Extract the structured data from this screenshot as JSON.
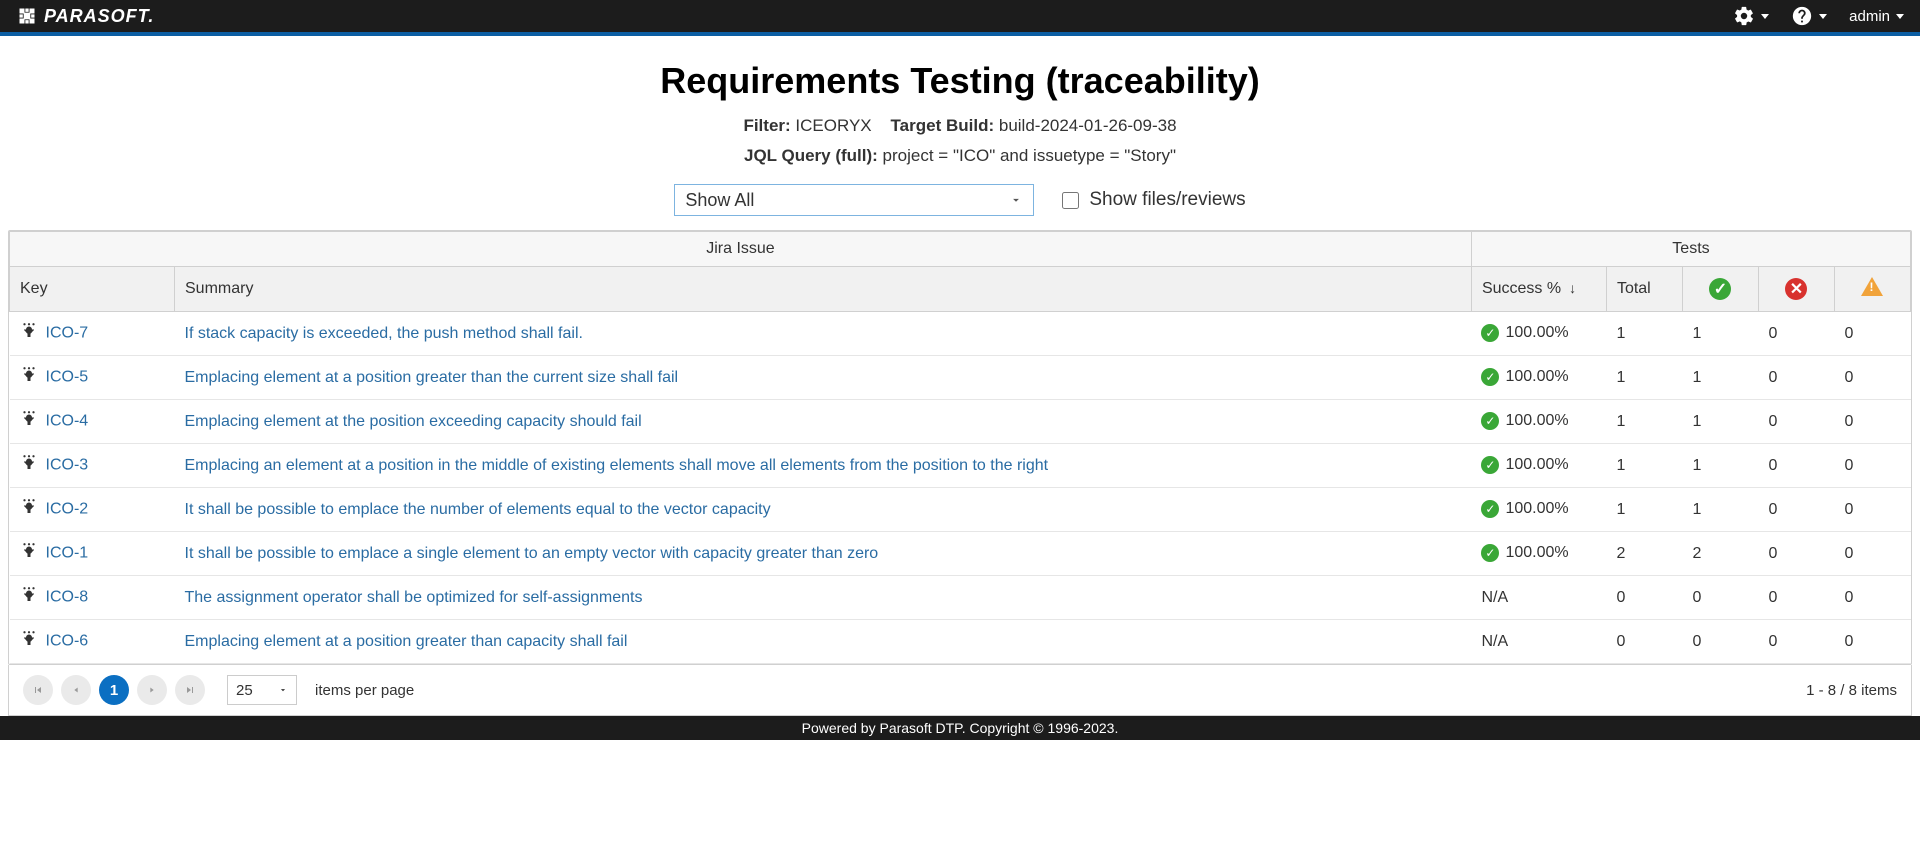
{
  "topbar": {
    "brand": "PARASOFT.",
    "user": "admin"
  },
  "page": {
    "title": "Requirements Testing (traceability)",
    "filter_label": "Filter:",
    "filter_value": "ICEORYX",
    "target_build_label": "Target Build:",
    "target_build_value": "build-2024-01-26-09-38",
    "jql_label": "JQL Query (full):",
    "jql_value": "project = \"ICO\" and issuetype = \"Story\""
  },
  "controls": {
    "select_value": "Show All",
    "checkbox_label": "Show files/reviews"
  },
  "table": {
    "group_headers": {
      "jira": "Jira Issue",
      "tests": "Tests"
    },
    "columns": {
      "key": "Key",
      "summary": "Summary",
      "success": "Success %",
      "total": "Total"
    },
    "rows": [
      {
        "key": "ICO-7",
        "summary": "If stack capacity is exceeded, the push method shall fail.",
        "success": "100.00%",
        "has_icon": true,
        "total": "1",
        "pass": "1",
        "fail": "0",
        "warn": "0"
      },
      {
        "key": "ICO-5",
        "summary": "Emplacing element at a position greater than the current size shall fail",
        "success": "100.00%",
        "has_icon": true,
        "total": "1",
        "pass": "1",
        "fail": "0",
        "warn": "0"
      },
      {
        "key": "ICO-4",
        "summary": "Emplacing element at the position exceeding capacity should fail",
        "success": "100.00%",
        "has_icon": true,
        "total": "1",
        "pass": "1",
        "fail": "0",
        "warn": "0"
      },
      {
        "key": "ICO-3",
        "summary": "Emplacing an element at a position in the middle of existing elements shall move all elements from the position to the right",
        "success": "100.00%",
        "has_icon": true,
        "total": "1",
        "pass": "1",
        "fail": "0",
        "warn": "0"
      },
      {
        "key": "ICO-2",
        "summary": "It shall be possible to emplace the number of elements equal to the vector capacity",
        "success": "100.00%",
        "has_icon": true,
        "total": "1",
        "pass": "1",
        "fail": "0",
        "warn": "0"
      },
      {
        "key": "ICO-1",
        "summary": "It shall be possible to emplace a single element to an empty vector with capacity greater than zero",
        "success": "100.00%",
        "has_icon": true,
        "total": "2",
        "pass": "2",
        "fail": "0",
        "warn": "0"
      },
      {
        "key": "ICO-8",
        "summary": "The assignment operator shall be optimized for self-assignments",
        "success": "N/A",
        "has_icon": false,
        "total": "0",
        "pass": "0",
        "fail": "0",
        "warn": "0"
      },
      {
        "key": "ICO-6",
        "summary": "Emplacing element at a position greater than capacity shall fail",
        "success": "N/A",
        "has_icon": false,
        "total": "0",
        "pass": "0",
        "fail": "0",
        "warn": "0"
      }
    ]
  },
  "pager": {
    "page": "1",
    "page_size": "25",
    "per_page_label": "items per page",
    "range": "1 - 8 / 8 items"
  },
  "footer": "Powered by Parasoft DTP. Copyright © 1996-2023."
}
